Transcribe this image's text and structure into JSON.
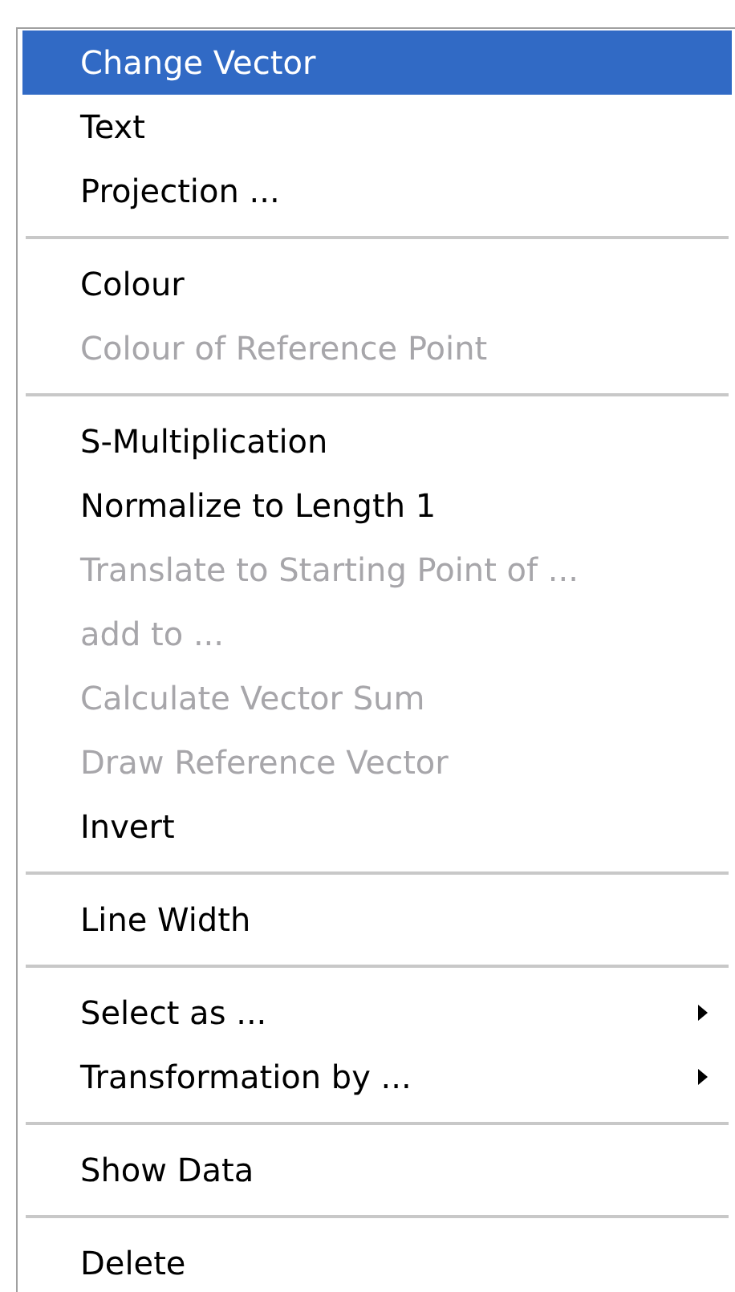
{
  "menu": {
    "sections": [
      {
        "items": [
          {
            "label": "Change Vector",
            "selected": true,
            "disabled": false,
            "submenu": false
          },
          {
            "label": "Text",
            "selected": false,
            "disabled": false,
            "submenu": false
          },
          {
            "label": "Projection ...",
            "selected": false,
            "disabled": false,
            "submenu": false
          }
        ]
      },
      {
        "items": [
          {
            "label": "Colour",
            "selected": false,
            "disabled": false,
            "submenu": false
          },
          {
            "label": "Colour of Reference Point",
            "selected": false,
            "disabled": true,
            "submenu": false
          }
        ]
      },
      {
        "items": [
          {
            "label": "S-Multiplication",
            "selected": false,
            "disabled": false,
            "submenu": false
          },
          {
            "label": "Normalize to Length 1",
            "selected": false,
            "disabled": false,
            "submenu": false
          },
          {
            "label": "Translate to Starting Point of ...",
            "selected": false,
            "disabled": true,
            "submenu": false
          },
          {
            "label": "add to ...",
            "selected": false,
            "disabled": true,
            "submenu": false
          },
          {
            "label": "Calculate Vector Sum",
            "selected": false,
            "disabled": true,
            "submenu": false
          },
          {
            "label": "Draw Reference Vector",
            "selected": false,
            "disabled": true,
            "submenu": false
          },
          {
            "label": "Invert",
            "selected": false,
            "disabled": false,
            "submenu": false
          }
        ]
      },
      {
        "items": [
          {
            "label": "Line Width",
            "selected": false,
            "disabled": false,
            "submenu": false
          }
        ]
      },
      {
        "items": [
          {
            "label": "Select as ...",
            "selected": false,
            "disabled": false,
            "submenu": true
          },
          {
            "label": "Transformation by ...",
            "selected": false,
            "disabled": false,
            "submenu": true
          }
        ]
      },
      {
        "items": [
          {
            "label": "Show Data",
            "selected": false,
            "disabled": false,
            "submenu": false
          }
        ]
      },
      {
        "items": [
          {
            "label": "Delete",
            "selected": false,
            "disabled": false,
            "submenu": false
          }
        ]
      }
    ]
  }
}
